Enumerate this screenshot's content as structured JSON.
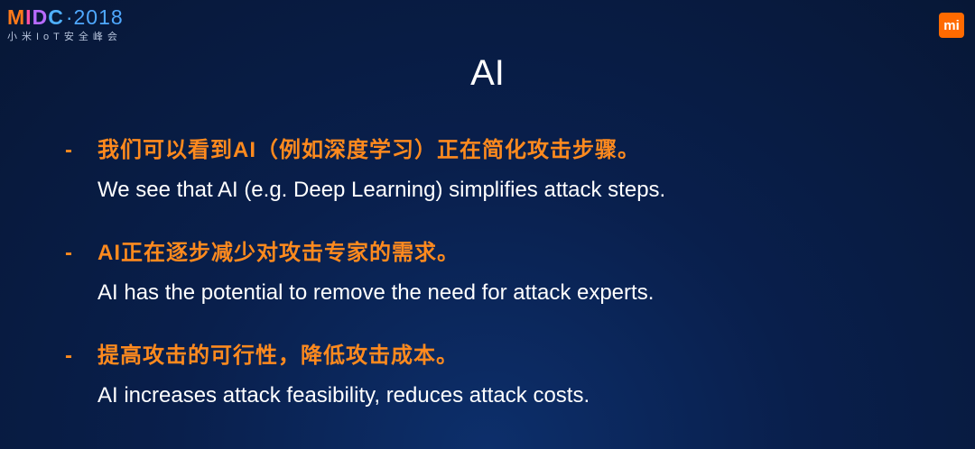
{
  "header": {
    "logo": {
      "m": "M",
      "i": "I",
      "d": "D",
      "c": "C",
      "dot": "·",
      "year": "2018",
      "subtitle": "小米IoT安全峰会"
    },
    "badge_label": "mi"
  },
  "slide": {
    "title": "AI",
    "bullets": [
      {
        "marker": "-",
        "zh": "我们可以看到AI（例如深度学习）正在简化攻击步骤。",
        "en": "We see that AI (e.g. Deep Learning) simplifies attack steps."
      },
      {
        "marker": "-",
        "zh": "AI正在逐步减少对攻击专家的需求。",
        "en": "AI has the potential to remove the need for attack experts."
      },
      {
        "marker": "-",
        "zh": "提高攻击的可行性，降低攻击成本。",
        "en": "AI increases attack feasibility, reduces attack costs."
      }
    ]
  },
  "colors": {
    "accent_orange": "#ff8a1e",
    "background": "#091f4c",
    "badge": "#ff6a00"
  }
}
